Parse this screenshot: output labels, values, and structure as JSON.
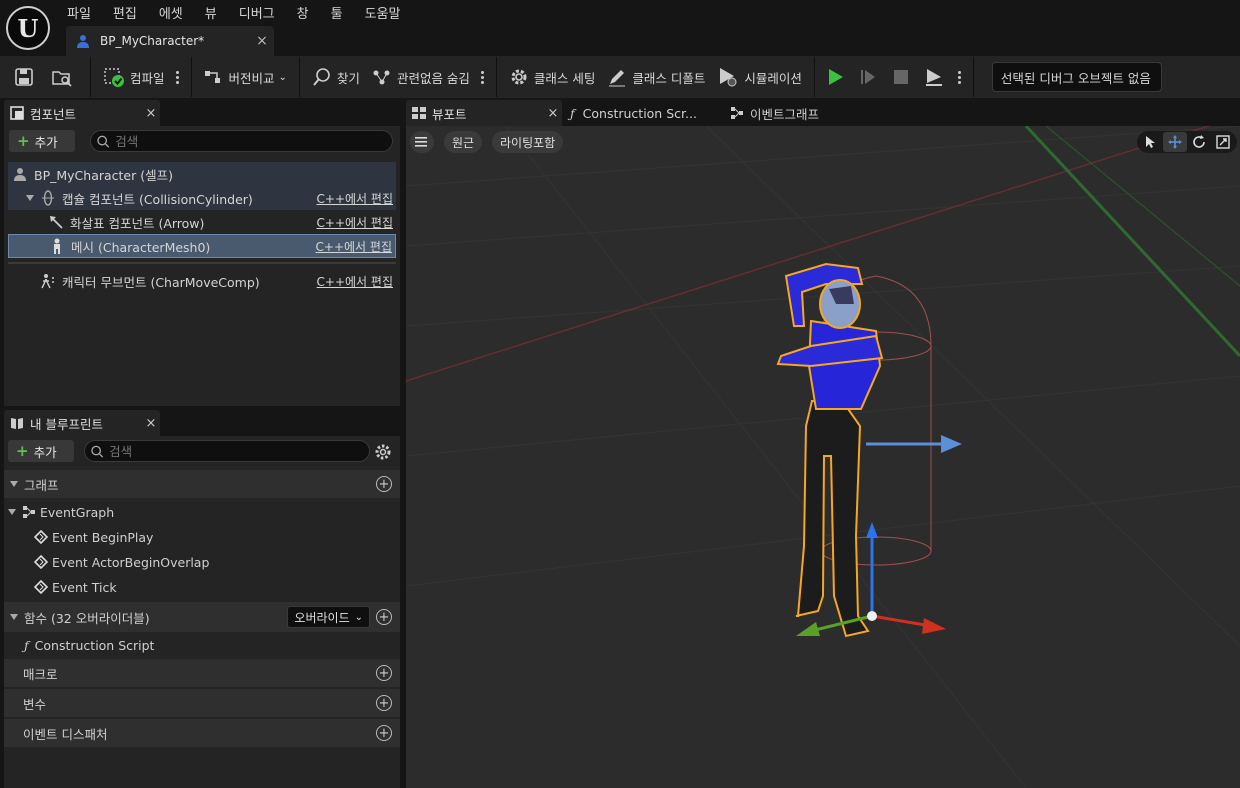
{
  "menu": [
    "파일",
    "편집",
    "에셋",
    "뷰",
    "디버그",
    "창",
    "툴",
    "도움말"
  ],
  "document_tab": {
    "label": "BP_MyCharacter*",
    "close": "×"
  },
  "toolbar": {
    "compile": "컴파일",
    "diff": "버전비교",
    "find": "찾기",
    "hide_unrelated": "관련없음 숨김",
    "class_settings": "클래스 세팅",
    "class_defaults": "클래스 디폴트",
    "simulation": "시뮬레이션",
    "debug_object": "선택된 디버그 오브젝트 없음"
  },
  "components": {
    "title": "컴포넌트",
    "close": "×",
    "add": "추가",
    "search_placeholder": "검색",
    "items": [
      {
        "label": "BP_MyCharacter (셀프)",
        "edit": ""
      },
      {
        "label": "캡슐 컴포넌트 (CollisionCylinder)",
        "edit": "C++에서 편집"
      },
      {
        "label": "화살표 컴포넌트 (Arrow)",
        "edit": "C++에서 편집"
      },
      {
        "label": "메시 (CharacterMesh0)",
        "edit": "C++에서 편집"
      },
      {
        "label": "캐릭터 무브먼트 (CharMoveComp)",
        "edit": "C++에서 편집"
      }
    ]
  },
  "my_blueprint": {
    "title": "내 블루프린트",
    "close": "×",
    "add": "추가",
    "search_placeholder": "검색",
    "graphs_header": "그래프",
    "event_graph": "EventGraph",
    "events": [
      "Event BeginPlay",
      "Event ActorBeginOverlap",
      "Event Tick"
    ],
    "functions_header": "함수 (32 오버라이더블)",
    "override": "오버라이드",
    "construction_script": "Construction Script",
    "macros_header": "매크로",
    "variables_header": "변수",
    "dispatchers_header": "이벤트 디스패처"
  },
  "viewport": {
    "tab": "뷰포트",
    "close": "×",
    "construction_tab": "Construction Scr...",
    "event_graph_tab": "이벤트그래프",
    "perspective": "원근",
    "lighting": "라이팅포함"
  },
  "colors": {
    "accent_green": "#3fbf3f",
    "selection": "#4a5a6e",
    "outline": "#f5a623"
  }
}
